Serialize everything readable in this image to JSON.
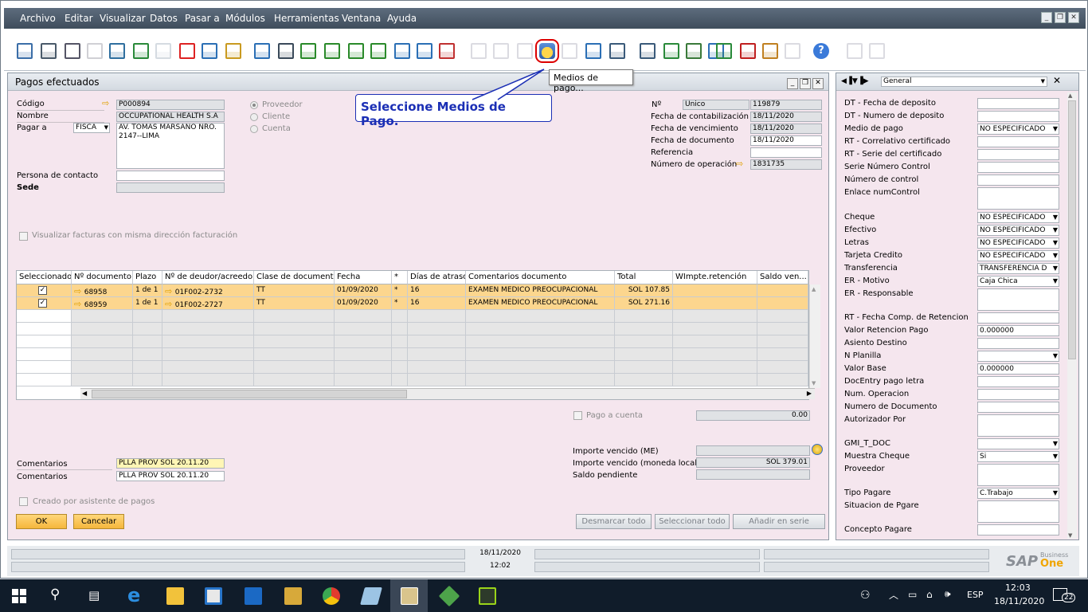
{
  "menu": [
    "Archivo",
    "Editar",
    "Visualizar",
    "Datos",
    "Pasar a",
    "Módulos",
    "Herramientas",
    "Ventana",
    "Ayuda"
  ],
  "toolbar": {
    "tooltip": "Medios de pago...",
    "icons": [
      "preview-icon",
      "print-icon",
      "email-icon",
      "sms-icon",
      "fax-icon",
      "excel-icon",
      "word-icon",
      "pdf-icon",
      "launch-app-icon",
      "lock-icon",
      "find-icon",
      "add-icon",
      "first-record-icon",
      "previous-record-icon",
      "next-record-icon",
      "last-record-icon",
      "refresh-icon",
      "filter-icon",
      "sort-icon",
      "base-document-icon",
      "target-document-icon",
      "journal-icon",
      "payment-means-icon",
      "transaction-journal-icon",
      "settings-icon",
      "form-settings-icon",
      "edit-icon",
      "add-data-icon",
      "tools-icon",
      "datasource-icon",
      "approval-icon",
      "messages-icon",
      "calendar-icon",
      "org-structure-icon",
      "help-icon",
      "doc-a-icon",
      "doc-b-icon"
    ]
  },
  "callout": "Seleccione Medios de Pago.",
  "form": {
    "title": "Pagos efectuados",
    "codigo_label": "Código",
    "codigo": "P000894",
    "nombre_label": "Nombre",
    "nombre": "OCCUPATIONAL HEALTH S.A",
    "pagar_a_label": "Pagar a",
    "pagar_a": "FISCA",
    "address1": "AV. TOMAS MARSANO NRO.",
    "address2": "2147--LIMA",
    "persona_label": "Persona de contacto",
    "sede_label": "Sede",
    "radio_proveedor": "Proveedor",
    "radio_cliente": "Cliente",
    "radio_cuenta": "Cuenta",
    "no_label": "Nº",
    "no_type": "Unico",
    "no_value": "119879",
    "fcont_label": "Fecha de contabilización",
    "fcont": "18/11/2020",
    "fvenc_label": "Fecha de vencimiento",
    "fvenc": "18/11/2020",
    "fdoc_label": "Fecha de documento",
    "fdoc": "18/11/2020",
    "ref_label": "Referencia",
    "nop_label": "Número de operación",
    "nop": "1831735",
    "visualizar_label": "Visualizar facturas con misma dirección facturación",
    "grid": {
      "headers": [
        "Seleccionado",
        "Nº documento",
        "Plazo",
        "Nº de deudor/acreedor",
        "Clase de documento",
        "Fecha",
        "*",
        "Días de atraso",
        "Comentarios documento",
        "Total",
        "WImpte.retención",
        "Saldo ven..."
      ],
      "rows": [
        [
          "",
          "68958",
          "1 de 1",
          "01F002-2732",
          "TT",
          "01/09/2020",
          "*",
          "16",
          "EXAMEN MEDICO PREOCUPACIONAL",
          "SOL 107.85",
          "",
          ""
        ],
        [
          "",
          "68959",
          "1 de 1",
          "01F002-2727",
          "TT",
          "01/09/2020",
          "*",
          "16",
          "EXAMEN MEDICO PREOCUPACIONAL",
          "SOL 271.16",
          "",
          ""
        ]
      ]
    },
    "pago_cuenta_label": "Pago a cuenta",
    "pago_cuenta": "0.00",
    "imp_me_label": "Importe vencido (ME)",
    "imp_ml_label": "Importe vencido (moneda local)",
    "imp_ml": "SOL 379.01",
    "saldo_label": "Saldo pendiente",
    "coment1_label": "Comentarios",
    "coment1": "PLLA PROV SOL 20.11.20",
    "coment2_label": "Comentarios",
    "coment2": "PLLA PROV SOL 20.11.20",
    "creado_label": "Creado por asistente de pagos",
    "ok": "OK",
    "cancel": "Cancelar",
    "desmarcar": "Desmarcar todo",
    "seleccionar": "Seleccionar todo",
    "anadir": "Añadir en serie"
  },
  "side": {
    "selector": "General",
    "fields": [
      {
        "label": "DT - Fecha de deposito",
        "value": ""
      },
      {
        "label": "DT - Numero de deposito",
        "value": ""
      },
      {
        "label": "Medio de pago",
        "value": "NO ESPECIFICADO"
      },
      {
        "label": "RT - Correlativo certificado",
        "value": ""
      },
      {
        "label": "RT - Serie del certificado",
        "value": ""
      },
      {
        "label": "Serie Número Control",
        "value": ""
      },
      {
        "label": "Número de control",
        "value": ""
      },
      {
        "label": "Enlace numControl",
        "value": ""
      },
      {
        "label": "Cheque",
        "value": "NO ESPECIFICADO"
      },
      {
        "label": "Efectivo",
        "value": "NO ESPECIFICADO"
      },
      {
        "label": "Letras",
        "value": "NO ESPECIFICADO"
      },
      {
        "label": "Tarjeta Credito",
        "value": "NO ESPECIFICADO"
      },
      {
        "label": "Transferencia",
        "value": "TRANSFERENCIA D"
      },
      {
        "label": "ER - Motivo",
        "value": "Caja Chica"
      },
      {
        "label": "ER - Responsable",
        "value": ""
      },
      {
        "label": "RT - Fecha Comp. de Retencion",
        "value": ""
      },
      {
        "label": "Valor Retencion Pago",
        "value": "0.000000"
      },
      {
        "label": "Asiento Destino",
        "value": ""
      },
      {
        "label": "N Planilla",
        "value": ""
      },
      {
        "label": "Valor Base",
        "value": "0.000000"
      },
      {
        "label": "DocEntry pago letra",
        "value": ""
      },
      {
        "label": "Num. Operacion",
        "value": ""
      },
      {
        "label": "Numero de Documento",
        "value": ""
      },
      {
        "label": "Autorizador Por",
        "value": ""
      },
      {
        "label": "GMI_T_DOC",
        "value": ""
      },
      {
        "label": "Muestra Cheque",
        "value": "Si"
      },
      {
        "label": "Proveedor",
        "value": ""
      },
      {
        "label": "Tipo Pagare",
        "value": "C.Trabajo"
      },
      {
        "label": "Situacion de Pgare",
        "value": ""
      },
      {
        "label": "Concepto Pagare",
        "value": ""
      }
    ]
  },
  "status": {
    "date": "18/11/2020",
    "time": "12:02"
  },
  "sap": {
    "brand": "SAP",
    "business": "Business",
    "one": "One"
  },
  "taskbar": {
    "lang": "ESP",
    "time": "12:03",
    "date": "18/11/2020",
    "badge": "22"
  }
}
